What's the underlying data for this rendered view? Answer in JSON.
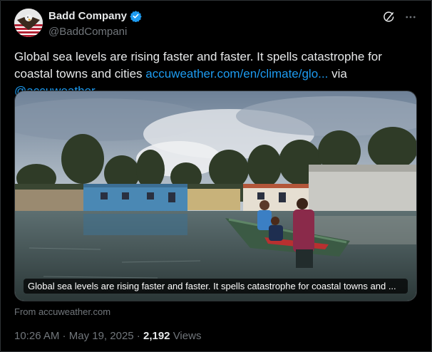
{
  "account": {
    "display_name": "Badd Company",
    "handle": "@BaddCompani",
    "verified_color": "#1d9bf0"
  },
  "actions": {
    "grok_icon": "slash-circle-icon",
    "more_icon": "more-icon"
  },
  "tweet": {
    "text_main": "Global sea levels are rising faster and faster. It spells catastrophe for coastal towns and cities ",
    "link_text": "accuweather.com/en/climate/glo...",
    "via_text": " via ",
    "mention": "@accuweather"
  },
  "card": {
    "caption": "Global sea levels are rising faster and faster. It spells catastrophe for coastal towns and ...",
    "source": "From accuweather.com"
  },
  "meta": {
    "time": "10:26 AM",
    "separator1": " · ",
    "date": "May 19, 2025",
    "separator2": " · ",
    "views_count": "2,192",
    "views_label": " Views"
  },
  "colors": {
    "background": "#000000",
    "text": "#e7e9ea",
    "muted": "#71767b",
    "link": "#1d9bf0",
    "border": "#2f3336"
  }
}
